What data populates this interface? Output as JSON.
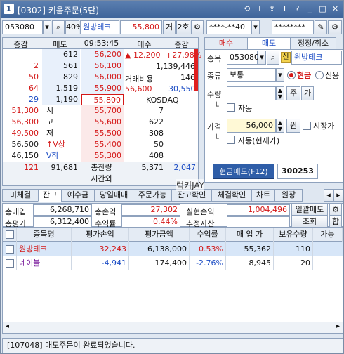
{
  "window": {
    "badge": "1",
    "title": "[0302] 키움주문(5단)",
    "icons": [
      "refresh-icon",
      "pin-icon",
      "upload-icon",
      "font-icon",
      "help-icon",
      "minimize-icon",
      "maximize-icon",
      "close-icon"
    ],
    "icon_glyphs": [
      "⟲",
      "⊤",
      "⇪",
      "T",
      "?",
      "_",
      "□",
      "✕"
    ]
  },
  "top_bar": {
    "code": "053080",
    "ratio": "40%",
    "stock_name": "원방테크",
    "price": "55,800",
    "btn_geo": "거",
    "btn_2ho": "2호",
    "account": "****-**40",
    "password": "********"
  },
  "quote": {
    "headers": [
      "증감",
      "매도",
      "09:53:45",
      "매수",
      "증감"
    ],
    "ask_rows": [
      {
        "inc": "",
        "ask": "612",
        "price": "56,200"
      },
      {
        "inc": "2",
        "ask": "561",
        "price": "56,100"
      },
      {
        "inc": "50",
        "ask": "829",
        "price": "56,000"
      },
      {
        "inc": "64",
        "ask": "1,519",
        "price": "55,900"
      },
      {
        "inc": "29",
        "ask": "1,190",
        "price": "55,800"
      }
    ],
    "info": {
      "change": "▲ 12,200",
      "change_pct": "+27.98%",
      "volume": "1,139,446",
      "cost_label": "거래비용",
      "cost_value": "146",
      "low": "56,600",
      "high": "30,550",
      "market": "KOSDAQ"
    },
    "bid_rows": [
      {
        "left": "51,300",
        "lab": "시",
        "price": "55,700",
        "bid": "7"
      },
      {
        "left": "56,300",
        "lab": "고",
        "price": "55,600",
        "bid": "622"
      },
      {
        "left": "49,500",
        "lab": "저",
        "price": "55,500",
        "bid": "308"
      },
      {
        "left": "56,500",
        "lab": "↑V상",
        "price": "55,400",
        "bid": "50"
      },
      {
        "left": "46,150",
        "lab": "V하",
        "price": "55,300",
        "bid": "408"
      }
    ],
    "totals": {
      "inc": "121",
      "ask": "91,681",
      "label": "총잔량",
      "bid": "5,371",
      "inc2": "2,047"
    },
    "after_hours": "시간외"
  },
  "order": {
    "tabs": [
      "매수",
      "매도",
      "정정/취소"
    ],
    "code_label": "종목",
    "code": "053080",
    "new_badge": "신",
    "stock_name": "원방테크",
    "type_label": "종류",
    "type_value": "보통",
    "radio_cash": "현금",
    "radio_credit": "신용",
    "qty_label": "수량",
    "qty_btn_ju": "주",
    "qty_btn_ga": "가",
    "auto1": "자동",
    "price_label": "가격",
    "price_value": "56,000",
    "price_unit": "원",
    "market_price": "시장가",
    "auto2": "자동(현재가)",
    "submit": "현금매도(F12)",
    "submit_value": "300253"
  },
  "lower_tabs": [
    "미체결",
    "잔고",
    "예수금",
    "당일매매",
    "주문가능",
    "잔고확인",
    "체결확인",
    "차트",
    "원장"
  ],
  "summary": {
    "row1": [
      {
        "label": "총매입",
        "value": "6,268,710"
      },
      {
        "label": "총손익",
        "value": "27,302"
      },
      {
        "label": "실현손익",
        "value": "1,004,496"
      }
    ],
    "row2": [
      {
        "label": "총평가",
        "value": "6,312,400"
      },
      {
        "label": "수익률",
        "value": "0.44%"
      },
      {
        "label": "추정자산",
        "value": ""
      }
    ],
    "btn_daily_sell": "일괄매도",
    "btn_lookup": "조회",
    "btn_sum": "합"
  },
  "grid": {
    "headers": [
      "종목명",
      "평가손익",
      "평가금액",
      "수익률",
      "매 입 가",
      "보유수량",
      "가능"
    ],
    "rows": [
      {
        "name": "원방테크",
        "pl": "32,243",
        "eval": "6,138,000",
        "rate": "0.53%",
        "buy": "55,362",
        "qty": "110"
      },
      {
        "name": "네이블",
        "pl": "-4,941",
        "eval": "174,400",
        "rate": "-2.76%",
        "buy": "8,945",
        "qty": "20"
      }
    ]
  },
  "watermark": "럭키JAY",
  "status": "[107048] 매도주문이 완료되었습니다."
}
